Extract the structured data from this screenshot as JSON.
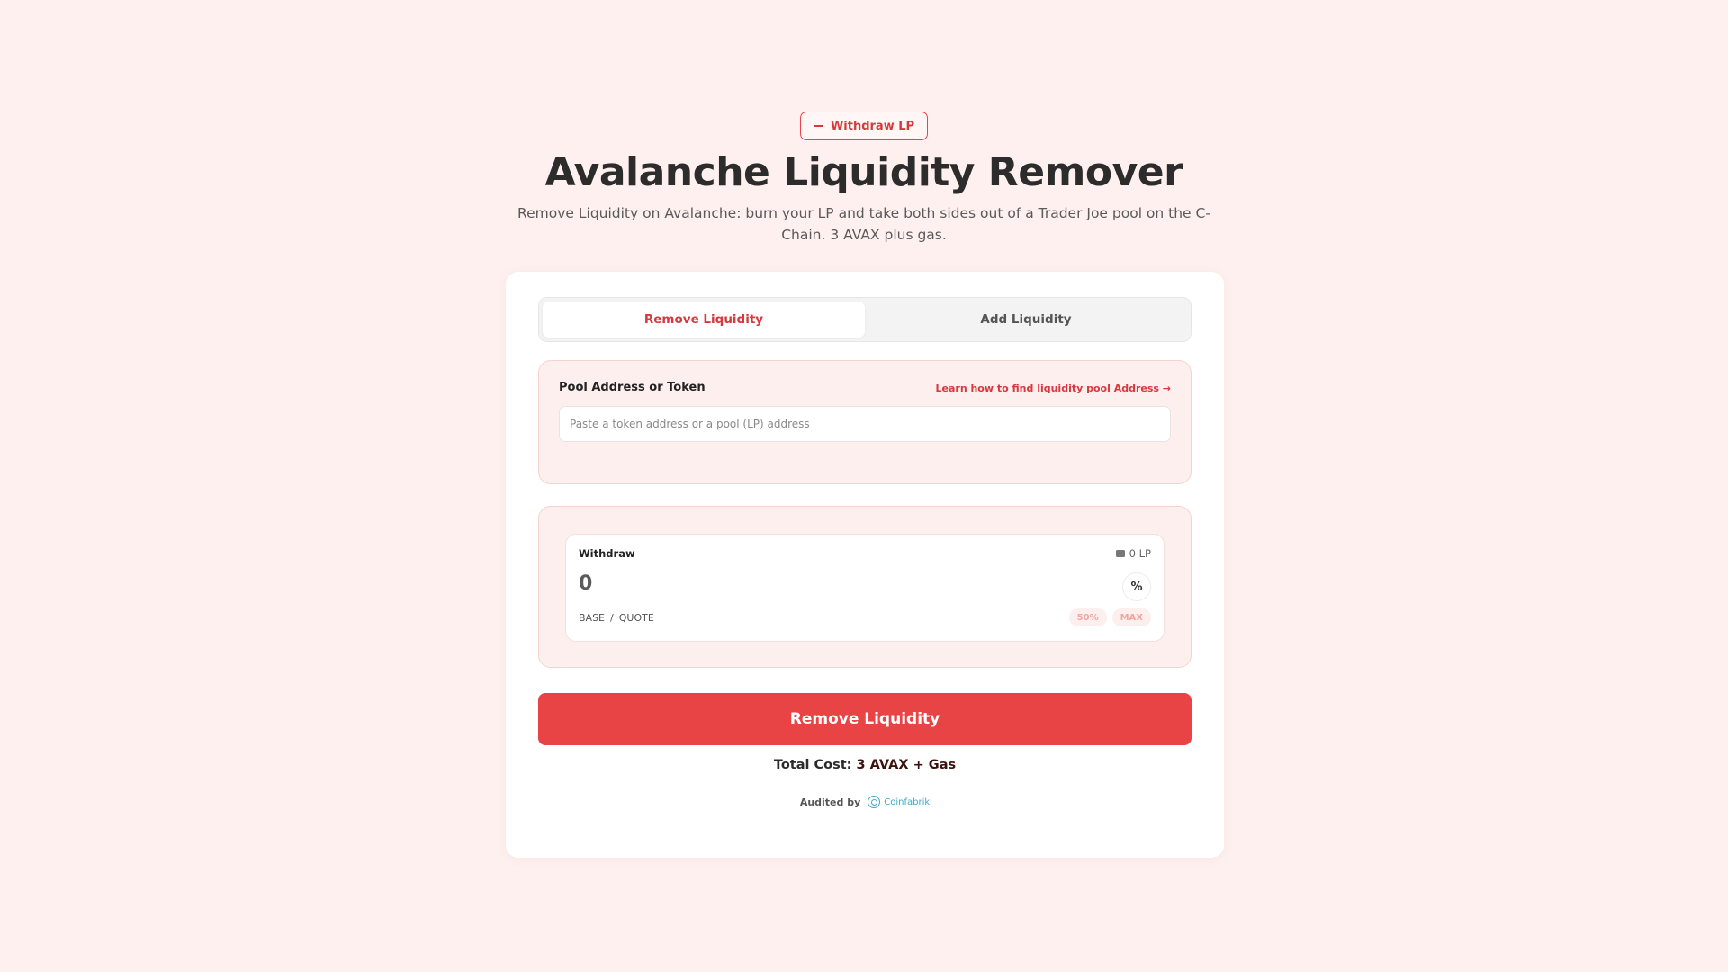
{
  "hero": {
    "badge_label": "Withdraw LP",
    "title": "Avalanche Liquidity Remover",
    "subtitle": "Remove Liquidity on Avalanche: burn your LP and take both sides out of a Trader Joe pool on the C-Chain. 3 AVAX plus gas."
  },
  "tabs": [
    {
      "label": "Remove Liquidity",
      "active": true
    },
    {
      "label": "Add Liquidity",
      "active": false
    }
  ],
  "pool": {
    "label": "Pool Address or Token",
    "help_link": "Learn how to find liquidity pool Address →",
    "input_value": "",
    "input_placeholder": "Paste a token address or a pool (LP) address"
  },
  "withdraw": {
    "label": "Withdraw",
    "balance": "0 LP",
    "amount": "0",
    "percent_button": "%",
    "base": "BASE",
    "separator": "/",
    "quote": "QUOTE",
    "quick_50": "50%",
    "quick_max": "MAX"
  },
  "action": {
    "button_label": "Remove Liquidity",
    "total_label": "Total Cost:",
    "total_value": "3 AVAX + Gas"
  },
  "audit": {
    "label": "Audited by",
    "auditor": "Coinfabrik"
  },
  "colors": {
    "accent": "#e84345",
    "background": "#fdf0ee",
    "panel": "#fcefed"
  }
}
